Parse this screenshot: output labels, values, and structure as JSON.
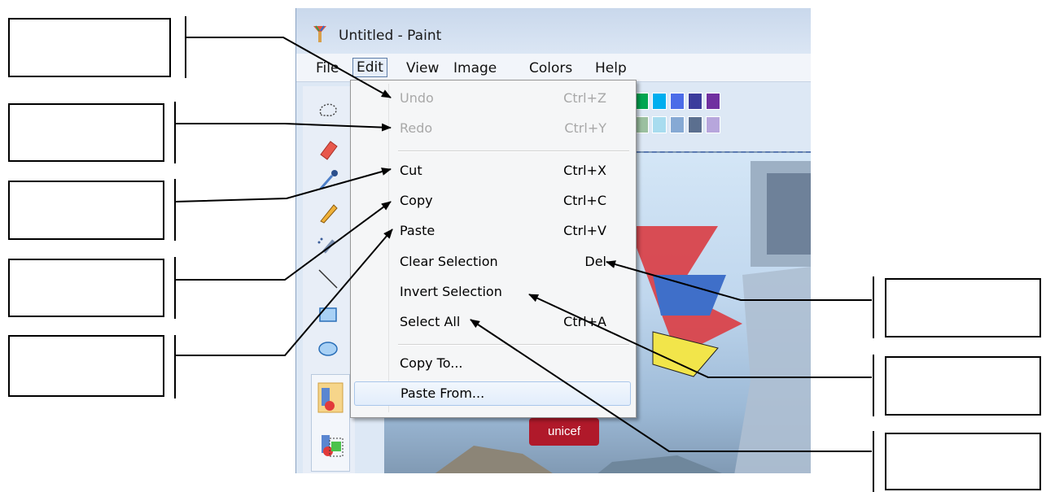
{
  "window": {
    "title": "Untitled - Paint",
    "icon": "paint-brush-icon"
  },
  "menubar": {
    "items": [
      "File",
      "Edit",
      "View",
      "Image",
      "Colors",
      "Help"
    ],
    "active": "Edit"
  },
  "edit_menu": {
    "items": [
      {
        "label": "Undo",
        "shortcut": "Ctrl+Z",
        "enabled": false
      },
      {
        "label": "Redo",
        "shortcut": "Ctrl+Y",
        "enabled": false
      },
      {
        "label": "Cut",
        "shortcut": "Ctrl+X",
        "enabled": true
      },
      {
        "label": "Copy",
        "shortcut": "Ctrl+C",
        "enabled": true
      },
      {
        "label": "Paste",
        "shortcut": "Ctrl+V",
        "enabled": true
      },
      {
        "label": "Clear Selection",
        "shortcut": "Del",
        "enabled": true
      },
      {
        "label": "Invert Selection",
        "shortcut": "",
        "enabled": true
      },
      {
        "label": "Select All",
        "shortcut": "Ctrl+A",
        "enabled": true
      },
      {
        "label": "Copy To...",
        "shortcut": "",
        "enabled": true
      },
      {
        "label": "Paste From...",
        "shortcut": "",
        "enabled": true,
        "highlighted": true
      }
    ]
  },
  "toolbox": {
    "icons": [
      "free-form-select-icon",
      "eraser-icon",
      "color-picker-icon",
      "pencil-icon",
      "airbrush-icon",
      "line-icon",
      "rectangle-icon",
      "ellipse-icon",
      "opaque-selection-icon",
      "transparent-selection-icon"
    ]
  },
  "palette": {
    "colors": [
      "#00a651",
      "#00aeef",
      "#4b6ce8",
      "#3c3c9c",
      "#7030a0",
      "#9bc0a0",
      "#a8dcef",
      "#86a9d4",
      "#5b6f8f",
      "#b7a6dc"
    ]
  },
  "canvas": {
    "badge_text": "unicef"
  },
  "labels": {
    "left_boxes": 5,
    "right_boxes": 3,
    "arrow_color": "#000000"
  }
}
